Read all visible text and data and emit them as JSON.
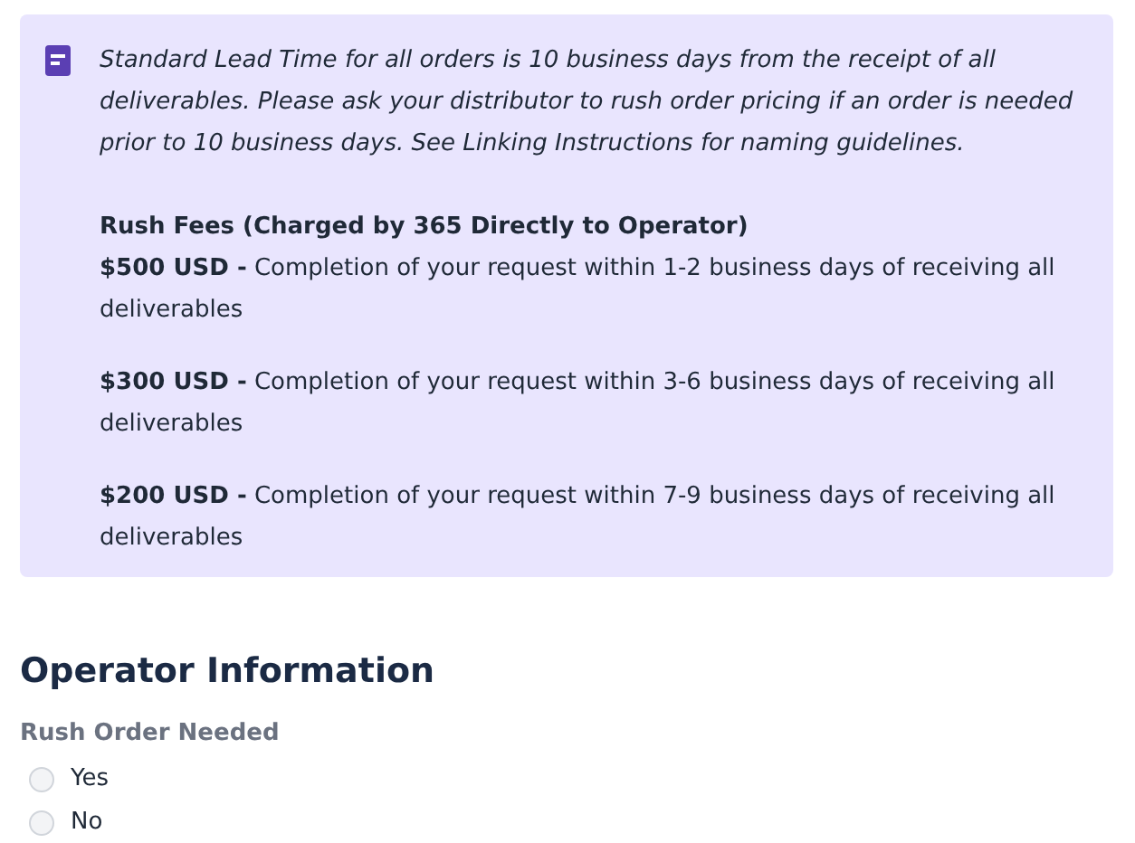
{
  "notice": {
    "intro": "Standard Lead Time for all orders is 10 business days from the receipt of all deliverables. Please ask your distributor to rush order pricing if an order is needed prior to 10 business days. See Linking Instructions for naming guidelines.",
    "fees_title": "Rush Fees (Charged by 365 Directly to Operator)",
    "fees": [
      "**$500 USD -** Completion of your request within 1-2 business days of receiving all deliverables",
      "**$300 USD -** Completion of your request within 3-6 business days of receiving all deliverables",
      "**$200 USD -** Completion of your request within 7-9 business days of receiving all deliverables"
    ]
  },
  "section": {
    "title": "Operator Information",
    "question": "Rush Order Needed",
    "options": [
      {
        "label": "Yes",
        "selected": false
      },
      {
        "label": "No",
        "selected": false
      }
    ]
  }
}
